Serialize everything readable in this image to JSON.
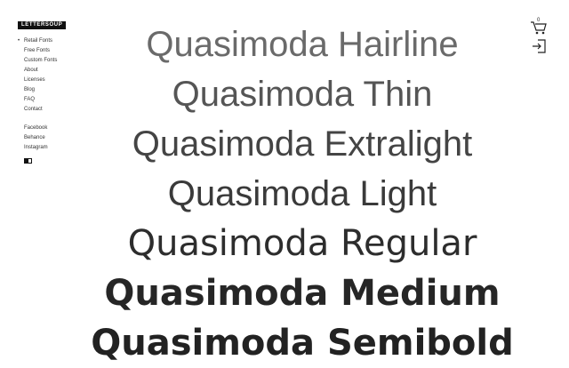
{
  "brand": {
    "logo": "LETTERSOUP"
  },
  "nav": {
    "main": [
      {
        "label": "Retail Fonts",
        "active": true
      },
      {
        "label": "Free Fonts"
      },
      {
        "label": "Custom Fonts"
      },
      {
        "label": "About"
      },
      {
        "label": "Licenses"
      },
      {
        "label": "Blog"
      },
      {
        "label": "FAQ"
      },
      {
        "label": "Contact"
      }
    ],
    "social": [
      {
        "label": "Facebook"
      },
      {
        "label": "Behance"
      },
      {
        "label": "Instagram"
      }
    ]
  },
  "header": {
    "cart_count": "0",
    "icons": [
      "cart-icon",
      "login-icon"
    ]
  },
  "specimens": [
    "Quasimoda Hairline",
    "Quasimoda Thin",
    "Quasimoda Extralight",
    "Quasimoda Light",
    "Quasimoda Regular",
    "Quasimoda Medium",
    "Quasimoda Semibold"
  ]
}
